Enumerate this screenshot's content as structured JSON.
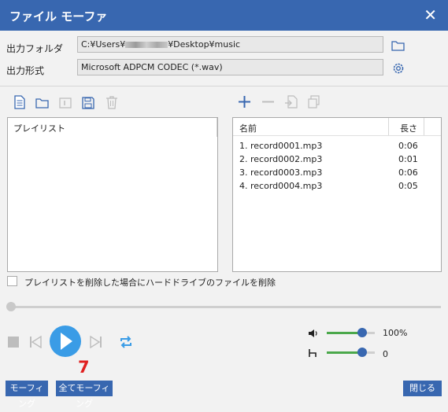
{
  "window": {
    "title": "ファイル モーファ",
    "close_label": "✕"
  },
  "output": {
    "folder_label": "出力フォルダ",
    "folder_value_prefix": "C:¥Users¥",
    "folder_value_suffix": "¥Desktop¥music",
    "format_label": "出力形式",
    "format_value": "Microsoft ADPCM CODEC (*.wav)"
  },
  "playlist": {
    "header": "プレイリスト"
  },
  "files": {
    "col_name": "名前",
    "col_length": "長さ",
    "rows": [
      {
        "name": "1. record0001.mp3",
        "length": "0:06"
      },
      {
        "name": "2. record0002.mp3",
        "length": "0:01"
      },
      {
        "name": "3. record0003.mp3",
        "length": "0:06"
      },
      {
        "name": "4. record0004.mp3",
        "length": "0:05"
      }
    ]
  },
  "options": {
    "delete_files_label": "プレイリストを削除した場合にハードドライブのファイルを削除"
  },
  "player": {
    "volume_value": "100%",
    "pitch_value": "0",
    "volume_level_percent": 100,
    "pitch_level_percent": 50
  },
  "annotation": {
    "marker": "7"
  },
  "buttons": {
    "morph": "モーフィング",
    "morph_all": "全てモーフィング",
    "close": "閉じる"
  },
  "colors": {
    "accent": "#3867b0",
    "marker": "#e02020",
    "play": "#3a9ce6"
  }
}
